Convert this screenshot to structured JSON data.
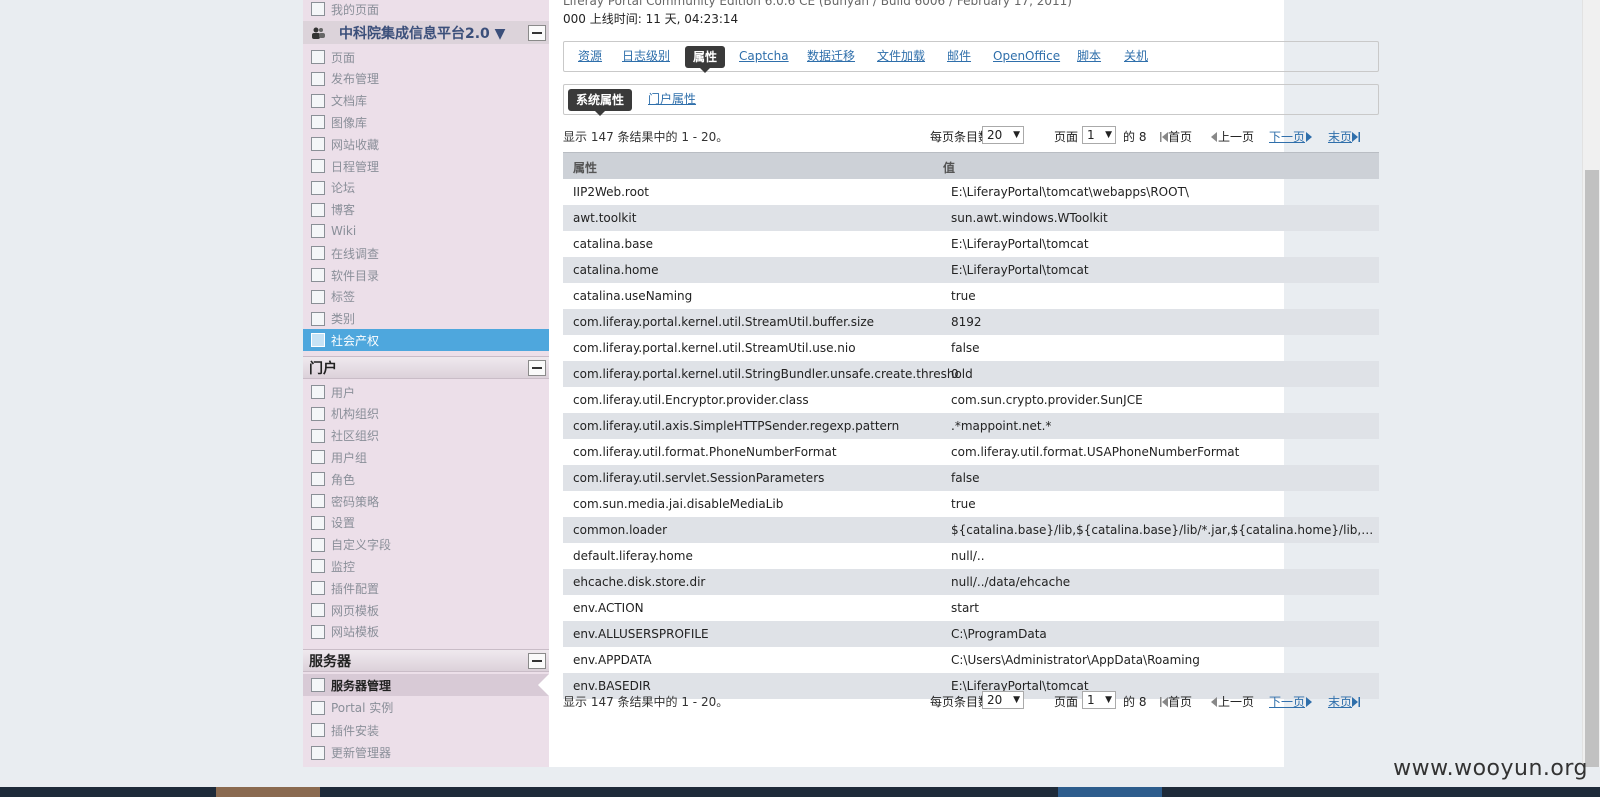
{
  "sidebar": {
    "top_item": "我的页面",
    "group_title": "中科院集成信息平台2.0 ▼",
    "content_items": [
      "页面",
      "发布管理",
      "文档库",
      "图像库",
      "网站收藏",
      "日程管理",
      "论坛",
      "博客",
      "Wiki",
      "在线调查",
      "软件目录",
      "标签",
      "类别",
      "社会产权"
    ],
    "portal_header": "门户",
    "portal_items": [
      "用户",
      "机构组织",
      "社区组织",
      "用户组",
      "角色",
      "密码策略",
      "设置",
      "自定义字段",
      "监控",
      "插件配置",
      "网页模板",
      "网站模板"
    ],
    "server_header": "服务器",
    "server_items": [
      "服务器管理",
      "Portal 实例",
      "插件安装",
      "更新管理器"
    ]
  },
  "main": {
    "uptime": "000 上线时间: 11 天, 04:23:14",
    "tabs": [
      "资源",
      "日志级别",
      "属性",
      "Captcha",
      "数据迁移",
      "文件加载",
      "邮件",
      "OpenOffice",
      "脚本",
      "关机"
    ],
    "subtabs": [
      "系统属性",
      "门户属性"
    ],
    "pager": {
      "count_text": "显示 147 条结果中的 1 - 20。",
      "per_page_label": "每页条目数",
      "per_page_value": "20",
      "page_label": "页面",
      "page_value": "1",
      "of_text": "的 8",
      "first": "首页",
      "prev": "上一页",
      "next": "下一页",
      "last": "末页"
    },
    "table": {
      "headers": [
        "属性",
        "值"
      ],
      "rows": [
        [
          "IIP2Web.root",
          "E:\\LiferayPortal\\tomcat\\webapps\\ROOT\\"
        ],
        [
          "awt.toolkit",
          "sun.awt.windows.WToolkit"
        ],
        [
          "catalina.base",
          "E:\\LiferayPortal\\tomcat"
        ],
        [
          "catalina.home",
          "E:\\LiferayPortal\\tomcat"
        ],
        [
          "catalina.useNaming",
          "true"
        ],
        [
          "com.liferay.portal.kernel.util.StreamUtil.buffer.size",
          "8192"
        ],
        [
          "com.liferay.portal.kernel.util.StreamUtil.use.nio",
          "false"
        ],
        [
          "com.liferay.portal.kernel.util.StringBundler.unsafe.create.threshold",
          "0"
        ],
        [
          "com.liferay.util.Encryptor.provider.class",
          "com.sun.crypto.provider.SunJCE"
        ],
        [
          "com.liferay.util.axis.SimpleHTTPSender.regexp.pattern",
          ".*mappoint.net.*"
        ],
        [
          "com.liferay.util.format.PhoneNumberFormat",
          "com.liferay.util.format.USAPhoneNumberFormat"
        ],
        [
          "com.liferay.util.servlet.SessionParameters",
          "false"
        ],
        [
          "com.sun.media.jai.disableMediaLib",
          "true"
        ],
        [
          "common.loader",
          "${catalina.base}/lib,${catalina.base}/lib/*.jar,${catalina.home}/lib,${catalina...."
        ],
        [
          "default.liferay.home",
          "null/.."
        ],
        [
          "ehcache.disk.store.dir",
          "null/../data/ehcache"
        ],
        [
          "env.ACTION",
          "start"
        ],
        [
          "env.ALLUSERSPROFILE",
          "C:\\ProgramData"
        ],
        [
          "env.APPDATA",
          "C:\\Users\\Administrator\\AppData\\Roaming"
        ],
        [
          "env.BASEDIR",
          "E:\\LiferayPortal\\tomcat"
        ]
      ]
    }
  },
  "watermark": "www.wooyun.org"
}
